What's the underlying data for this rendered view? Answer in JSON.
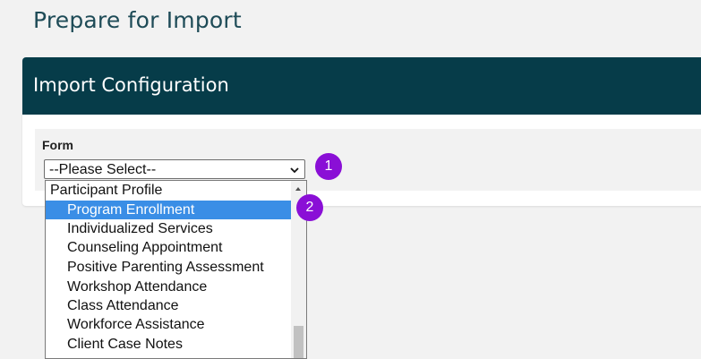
{
  "page": {
    "title": "Prepare for Import"
  },
  "panel": {
    "title": "Import Configuration"
  },
  "form": {
    "label": "Form",
    "select": {
      "value": "--Please Select--"
    }
  },
  "callouts": [
    "1",
    "2"
  ],
  "dropdown": {
    "group": "Participant Profile",
    "options": [
      "Program Enrollment",
      "Individualized Services",
      "Counseling Appointment",
      "Positive Parenting Assessment",
      "Workshop Attendance",
      "Class Attendance",
      "Workforce Assistance",
      "Client Case Notes"
    ],
    "highlighted_option": "Program Enrollment"
  },
  "colors": {
    "header_bg": "#063c49",
    "title_text": "#1e4b57",
    "highlight": "#3a8ee6",
    "callout": "#8a0fd6"
  }
}
